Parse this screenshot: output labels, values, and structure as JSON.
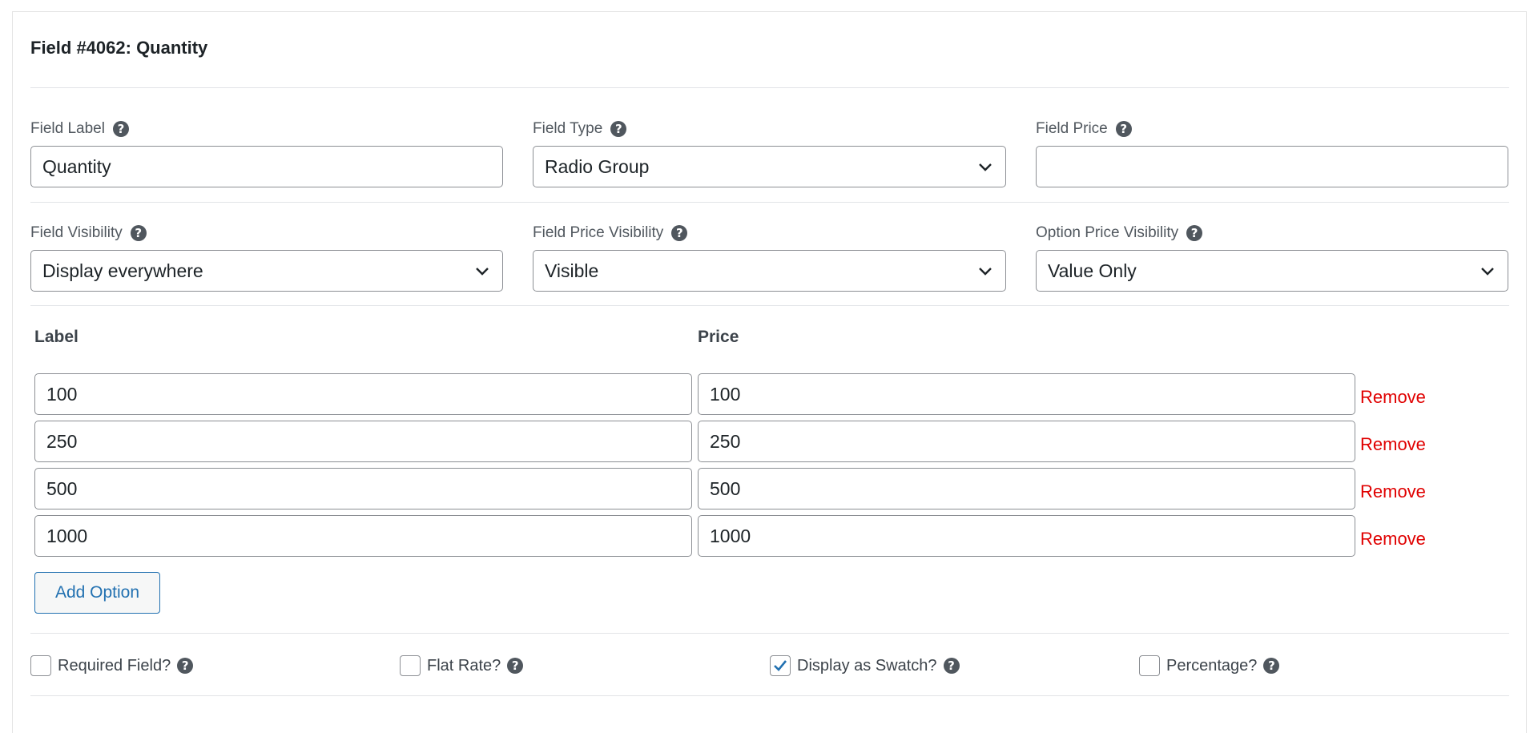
{
  "field": {
    "title": "Field #4062: Quantity"
  },
  "row1": {
    "label": {
      "label": "Field Label",
      "value": "Quantity"
    },
    "type": {
      "label": "Field Type",
      "value": "Radio Group"
    },
    "price": {
      "label": "Field Price",
      "value": ""
    }
  },
  "row2": {
    "visibility": {
      "label": "Field Visibility",
      "value": "Display everywhere"
    },
    "price_visibility": {
      "label": "Field Price Visibility",
      "value": "Visible"
    },
    "option_price_visibility": {
      "label": "Option Price Visibility",
      "value": "Value Only"
    }
  },
  "options": {
    "label_header": "Label",
    "price_header": "Price",
    "remove_label": "Remove",
    "rows": [
      {
        "label": "100",
        "price": "100"
      },
      {
        "label": "250",
        "price": "250"
      },
      {
        "label": "500",
        "price": "500"
      },
      {
        "label": "1000",
        "price": "1000"
      }
    ],
    "add_label": "Add Option"
  },
  "checks": [
    {
      "label": "Required Field?",
      "checked": false
    },
    {
      "label": "Flat Rate?",
      "checked": false
    },
    {
      "label": "Display as Swatch?",
      "checked": true
    },
    {
      "label": "Percentage?",
      "checked": false
    }
  ],
  "help_glyph": "?",
  "colors": {
    "accent": "#2271b1",
    "remove": "#e00000",
    "border": "#8c8f94"
  }
}
